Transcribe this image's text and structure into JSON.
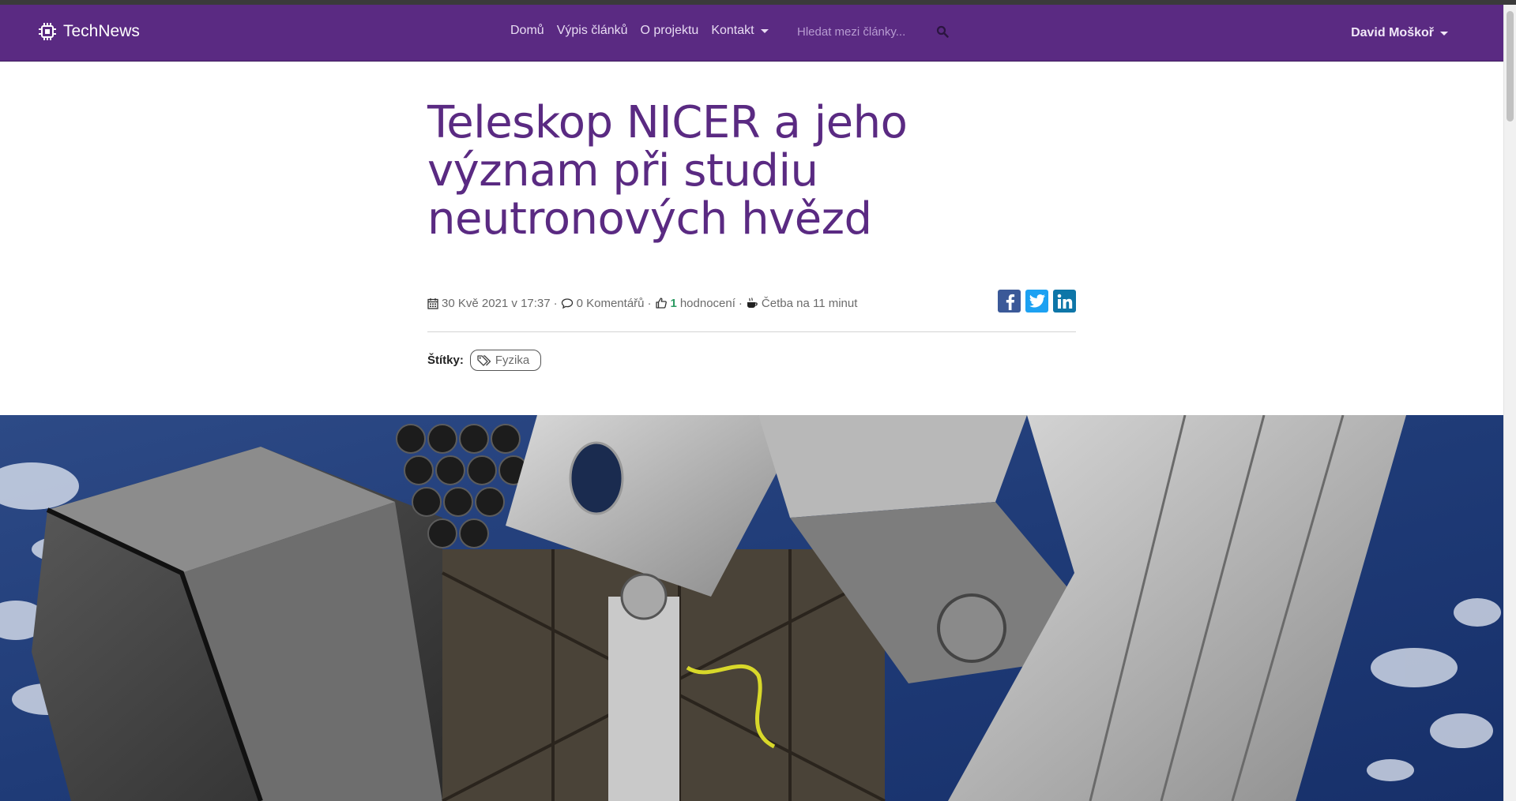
{
  "brand": {
    "name": "TechNews",
    "icon": "chip-icon"
  },
  "nav": {
    "items": [
      {
        "label": "Domů"
      },
      {
        "label": "Výpis článků"
      },
      {
        "label": "O projektu"
      },
      {
        "label": "Kontakt"
      }
    ],
    "search_placeholder": "Hledat mezi články...",
    "user": "David Moškoř"
  },
  "article": {
    "title": "Teleskop NICER a jeho význam při studiu neutronových hvězd",
    "date": "30 Kvě 2021 v 17:37",
    "comments": "0 Komentářů",
    "likes_count": "1",
    "likes_label": "hodnocení",
    "reading_time": "Četba na 11 minut",
    "tags_label": "Štítky:",
    "tags": [
      "Fyzika"
    ]
  },
  "colors": {
    "navbar": "#5a2a82",
    "title": "#5a2a82",
    "facebook": "#3b5998",
    "twitter": "#1da1f2",
    "linkedin": "#0e76a8"
  }
}
